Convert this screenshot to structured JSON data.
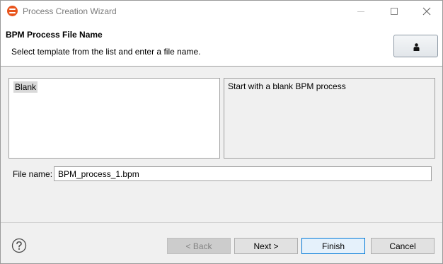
{
  "window": {
    "title": "Process Creation Wizard"
  },
  "header": {
    "title": "BPM Process File Name",
    "description": "Select template from the list and enter a file name."
  },
  "templates": {
    "items": [
      "Blank"
    ],
    "selected": "Blank",
    "description": "Start with a blank BPM process"
  },
  "file": {
    "label": "File name:",
    "value": "BPM_process_1.bpm"
  },
  "footer": {
    "back_label": "< Back",
    "next_label": "Next >",
    "finish_label": "Finish",
    "cancel_label": "Cancel"
  },
  "colors": {
    "accent": "#0078d7",
    "app_icon": "#e8541c"
  },
  "icons": {
    "app": "eclipse-orange-icon",
    "minimize": "minimize-icon",
    "maximize": "maximize-icon",
    "close": "close-icon",
    "header_image": "person-icon",
    "help": "help-icon"
  }
}
